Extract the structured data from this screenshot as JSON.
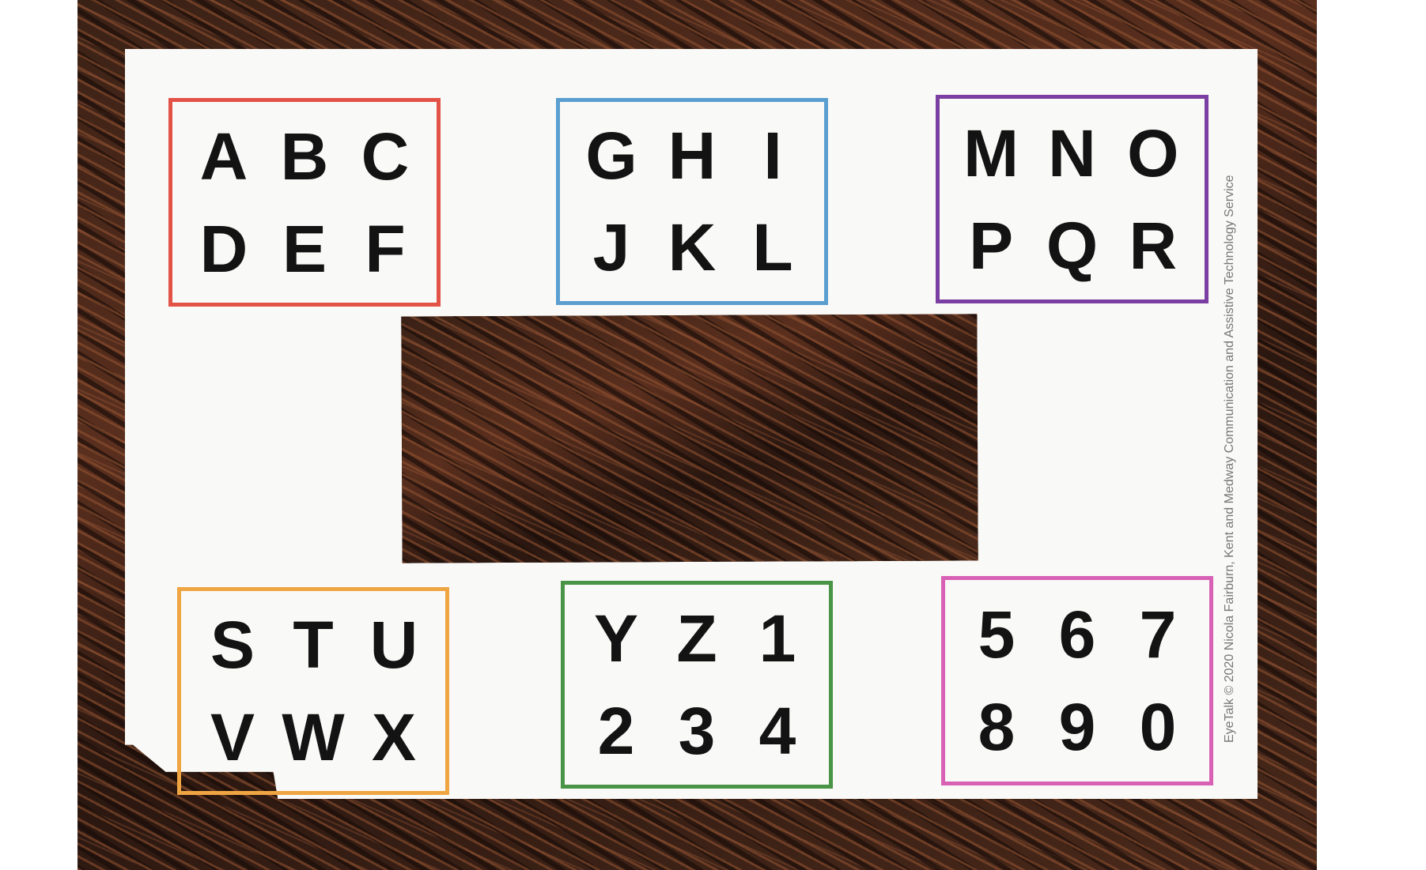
{
  "cards": [
    {
      "color": "#e35247",
      "letters": [
        "A",
        "B",
        "C",
        "D",
        "E",
        "F"
      ]
    },
    {
      "color": "#5b9fd0",
      "letters": [
        "G",
        "H",
        "I",
        "J",
        "K",
        "L"
      ]
    },
    {
      "color": "#7b3fa3",
      "letters": [
        "M",
        "N",
        "O",
        "P",
        "Q",
        "R"
      ]
    },
    {
      "color": "#f0a543",
      "letters": [
        "S",
        "T",
        "U",
        "V",
        "W",
        "X"
      ]
    },
    {
      "color": "#4a9447",
      "letters": [
        "Y",
        "Z",
        "1",
        "2",
        "3",
        "4"
      ]
    },
    {
      "color": "#d860b5",
      "letters": [
        "5",
        "6",
        "7",
        "8",
        "9",
        "0"
      ]
    }
  ],
  "credit": "EyeTalk © 2020 Nicola Fairburn, Kent and Medway Communication and Assistive Technology Service"
}
